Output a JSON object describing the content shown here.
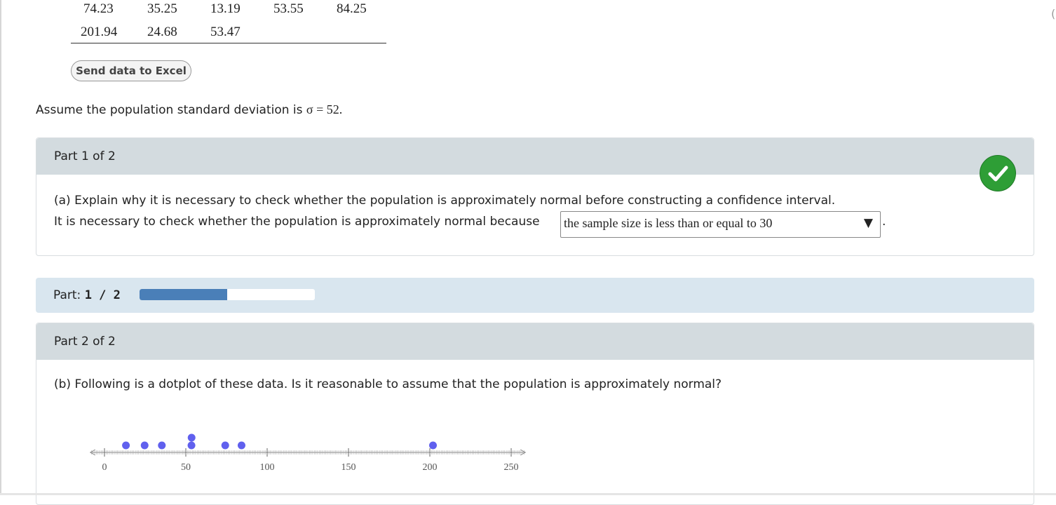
{
  "data_table": {
    "rows": [
      [
        "74.23",
        "35.25",
        "13.19",
        "53.55",
        "84.25"
      ],
      [
        "201.94",
        "24.68",
        "53.47"
      ]
    ]
  },
  "send_excel_label": "Send data to Excel",
  "assumption": {
    "prefix": "Assume the population standard deviation is ",
    "sigma_expr": "σ = 52."
  },
  "part1": {
    "heading": "Part 1 of 2",
    "status_icon": "check-icon",
    "status_color": "#2e9e36",
    "question_a": "(a) Explain why it is necessary to check whether the population is approximately normal before constructing a confidence interval.",
    "prompt": "It is necessary to check whether the population is approximately normal because",
    "selected_answer": "the sample size is less than or equal to 30",
    "trailing": "."
  },
  "progress": {
    "label": "Part: ",
    "value_text": "1 / 2",
    "fraction": 0.5,
    "fill_color": "#4a7fb8"
  },
  "part2": {
    "heading": "Part 2 of 2",
    "question_b": "(b) Following is a dotplot of these data. Is it reasonable to assume that the population is approximately normal?"
  },
  "chart_data": {
    "type": "scatter",
    "title": "",
    "xlabel": "",
    "ylabel": "",
    "xlim": [
      -10,
      260
    ],
    "ticks": [
      0,
      50,
      100,
      150,
      200,
      250
    ],
    "tick_labels": [
      "0",
      "50",
      "100",
      "150",
      "200",
      "250"
    ],
    "values": [
      13.19,
      24.68,
      35.25,
      53.47,
      53.55,
      74.23,
      84.25,
      201.94
    ],
    "dot_color": "#6060ee",
    "grid": false
  }
}
